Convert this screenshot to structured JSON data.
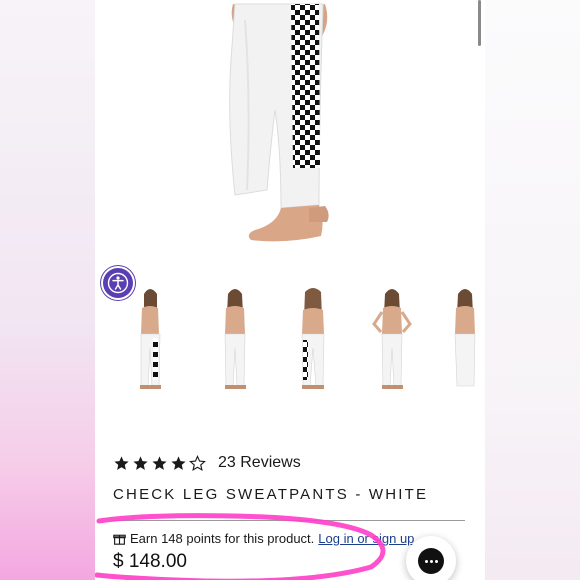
{
  "product": {
    "rating": 4,
    "rating_max": 5,
    "reviews_label": "23 Reviews",
    "title": "CHECK LEG SWEATPANTS - WHITE",
    "points_text": "Earn 148 points for this product.",
    "points_link": "Log in or sign up",
    "price": "$ 148.00"
  },
  "gallery": {
    "thumbnails": [
      {
        "pose": "front-checker-left"
      },
      {
        "pose": "front-plain"
      },
      {
        "pose": "back-checker"
      },
      {
        "pose": "front-hands-hips"
      },
      {
        "pose": "side-partial"
      }
    ]
  },
  "icons": {
    "accessibility": "accessibility-icon",
    "points": "gift-icon",
    "chat": "chat-icon",
    "star_filled": "star-filled-icon",
    "star_empty": "star-outline-icon"
  },
  "colors": {
    "accessibility_bg": "#5a3fb3",
    "highlight": "#ff3ec8",
    "link": "#1c3f8c",
    "text": "#1a1a1a"
  }
}
